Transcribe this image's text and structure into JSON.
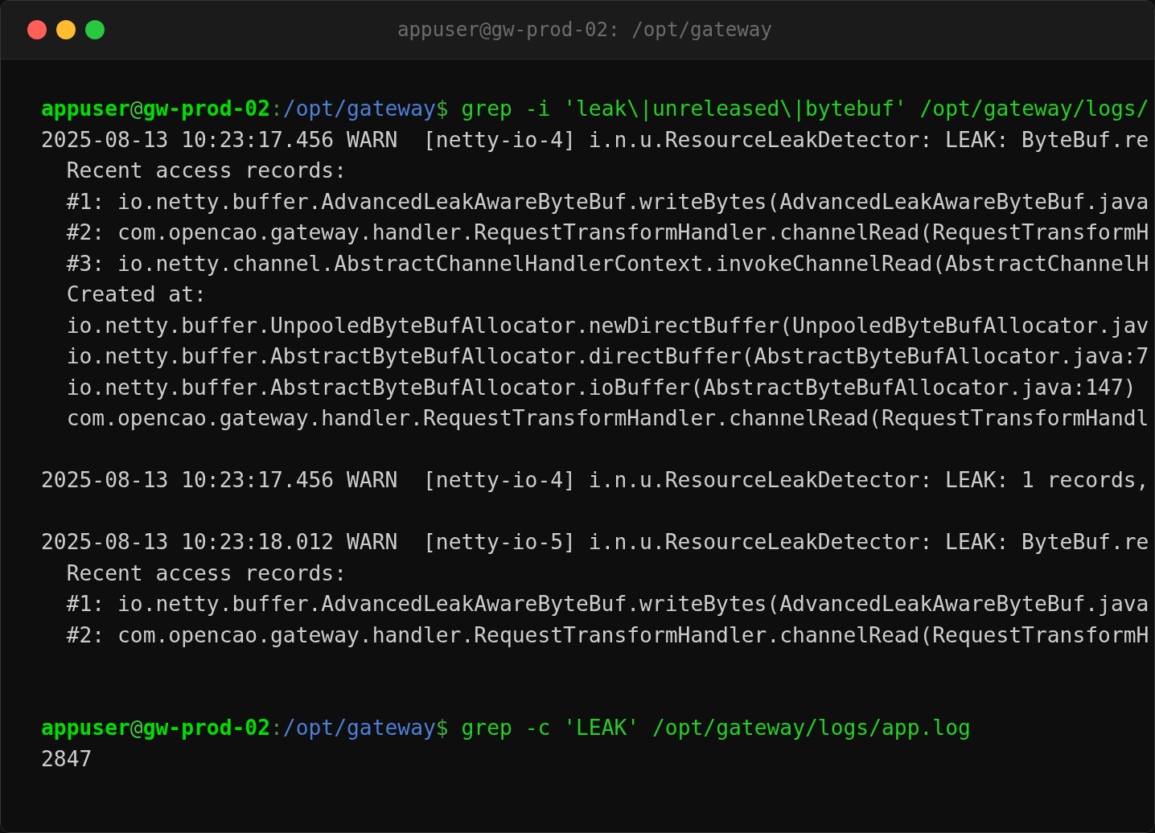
{
  "window": {
    "title": "appuser@gw-prod-02: /opt/gateway"
  },
  "terminal": {
    "lines": [
      {
        "kind": "prompt",
        "user": "appuser",
        "at": "@",
        "host": "gw-prod-02",
        "colon": ":",
        "path": "/opt/gateway",
        "dollar": "$",
        "command": "grep -i 'leak\\|unreleased\\|bytebuf' /opt/gateway/logs/"
      },
      {
        "kind": "log",
        "text": "2025-08-13 10:23:17.456 WARN  [netty-io-4] i.n.u.ResourceLeakDetector: LEAK: ByteBuf.re",
        "children": [
          {
            "kind": "output",
            "text": "Recent access records:"
          },
          {
            "kind": "output",
            "text": "#1: io.netty.buffer.AdvancedLeakAwareByteBuf.writeBytes(AdvancedLeakAwareByteBuf.java"
          },
          {
            "kind": "output",
            "text": "#2: com.opencao.gateway.handler.RequestTransformHandler.channelRead(RequestTransformH"
          },
          {
            "kind": "output",
            "text": "#3: io.netty.channel.AbstractChannelHandlerContext.invokeChannelRead(AbstractChannelH"
          },
          {
            "kind": "output",
            "text": "Created at:"
          },
          {
            "kind": "output",
            "text": "io.netty.buffer.UnpooledByteBufAllocator.newDirectBuffer(UnpooledByteBufAllocator.jav"
          },
          {
            "kind": "output",
            "text": "io.netty.buffer.AbstractByteBufAllocator.directBuffer(AbstractByteBufAllocator.java:7"
          },
          {
            "kind": "output",
            "text": "io.netty.buffer.AbstractByteBufAllocator.ioBuffer(AbstractByteBufAllocator.java:147)"
          },
          {
            "kind": "output",
            "text": "com.opencao.gateway.handler.RequestTransformHandler.channelRead(RequestTransformHandl"
          }
        ]
      },
      {
        "kind": "blank"
      },
      {
        "kind": "log",
        "text": "2025-08-13 10:23:17.456 WARN  [netty-io-4] i.n.u.ResourceLeakDetector: LEAK: 1 records,"
      },
      {
        "kind": "blank"
      },
      {
        "kind": "log",
        "text": "2025-08-13 10:23:18.012 WARN  [netty-io-5] i.n.u.ResourceLeakDetector: LEAK: ByteBuf.re",
        "children": [
          {
            "kind": "output",
            "text": "Recent access records:"
          },
          {
            "kind": "output",
            "text": "#1: io.netty.buffer.AdvancedLeakAwareByteBuf.writeBytes(AdvancedLeakAwareByteBuf.java"
          },
          {
            "kind": "output",
            "text": "#2: com.opencao.gateway.handler.RequestTransformHandler.channelRead(RequestTransformH"
          }
        ]
      },
      {
        "kind": "blank"
      },
      {
        "kind": "blank"
      },
      {
        "kind": "prompt",
        "user": "appuser",
        "at": "@",
        "host": "gw-prod-02",
        "colon": ":",
        "path": "/opt/gateway",
        "dollar": "$",
        "command": "grep -c 'LEAK' /opt/gateway/logs/app.log"
      },
      {
        "kind": "output",
        "text": "2847"
      }
    ]
  }
}
